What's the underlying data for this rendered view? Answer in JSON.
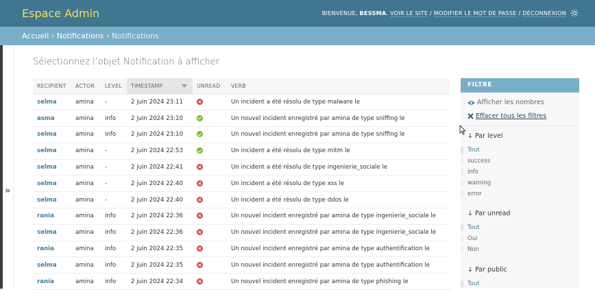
{
  "header": {
    "site_name": "Espace Admin",
    "welcome": "BIENVENUE,",
    "username": "BESSMA",
    "view_site": "VOIR LE SITE",
    "change_password": "MODIFIER LE MOT DE PASSE",
    "logout": "DÉCONNEXION",
    "sep": "/"
  },
  "breadcrumbs": {
    "home": "Accueil",
    "app": "Notifications",
    "current": "Notifications",
    "sep": "›"
  },
  "content": {
    "title": "Sélectionnez l’objet Notification à afficher"
  },
  "table": {
    "columns": [
      "RECIPIENT",
      "ACTOR",
      "LEVEL",
      "TIMESTAMP",
      "UNREAD",
      "VERB"
    ],
    "rows": [
      {
        "recipient": "selma",
        "actor": "amina",
        "level": "-",
        "timestamp": "2 juin 2024 23:11",
        "unread": false,
        "verb": "Un incident a été résolu de type malware le"
      },
      {
        "recipient": "asma",
        "actor": "amina",
        "level": "info",
        "timestamp": "2 juin 2024 23:10",
        "unread": true,
        "verb": "Un nouvel incident enregistré par amina de type sniffing le"
      },
      {
        "recipient": "selma",
        "actor": "amina",
        "level": "info",
        "timestamp": "2 juin 2024 23:10",
        "unread": true,
        "verb": "Un nouvel incident enregistré par amina de type sniffing le"
      },
      {
        "recipient": "selma",
        "actor": "amina",
        "level": "-",
        "timestamp": "2 juin 2024 22:53",
        "unread": true,
        "verb": "Un incident a été résolu de type mitm le"
      },
      {
        "recipient": "selma",
        "actor": "amina",
        "level": "-",
        "timestamp": "2 juin 2024 22:41",
        "unread": false,
        "verb": "Un incident a été résolu de type ingenierie_sociale le"
      },
      {
        "recipient": "selma",
        "actor": "amina",
        "level": "-",
        "timestamp": "2 juin 2024 22:40",
        "unread": false,
        "verb": "Un incident a été résolu de type xss le"
      },
      {
        "recipient": "selma",
        "actor": "amina",
        "level": "-",
        "timestamp": "2 juin 2024 22:40",
        "unread": false,
        "verb": "Un incident a été résolu de type ddos le"
      },
      {
        "recipient": "rania",
        "actor": "amina",
        "level": "info",
        "timestamp": "2 juin 2024 22:36",
        "unread": false,
        "verb": "Un nouvel incident enregistré par amina de type ingenierie_sociale le"
      },
      {
        "recipient": "selma",
        "actor": "amina",
        "level": "info",
        "timestamp": "2 juin 2024 22:36",
        "unread": false,
        "verb": "Un nouvel incident enregistré par amina de type ingenierie_sociale le"
      },
      {
        "recipient": "rania",
        "actor": "amina",
        "level": "info",
        "timestamp": "2 juin 2024 22:35",
        "unread": false,
        "verb": "Un nouvel incident enregistré par amina de type authentification le"
      },
      {
        "recipient": "selma",
        "actor": "amina",
        "level": "info",
        "timestamp": "2 juin 2024 22:35",
        "unread": false,
        "verb": "Un nouvel incident enregistré par amina de type authentification le"
      },
      {
        "recipient": "rania",
        "actor": "amina",
        "level": "info",
        "timestamp": "2 juin 2024 22:34",
        "unread": false,
        "verb": "Un nouvel incident enregistré par amina de type phishing le"
      }
    ]
  },
  "filter": {
    "title": "FILTRE",
    "show_counts": "Afficher les nombres",
    "clear_all": "Effacer tous les filtres",
    "by_level": {
      "heading": "↓ Par level",
      "options": [
        "Tout",
        "success",
        "info",
        "warning",
        "error"
      ]
    },
    "by_unread": {
      "heading": "↓ Par unread",
      "options": [
        "Tout",
        "Oui",
        "Non"
      ]
    },
    "by_public": {
      "heading": "↓ Par public",
      "options": [
        "Tout"
      ]
    }
  },
  "nav_toggle": "»",
  "colors": {
    "header": "#417690",
    "breadcrumbs": "#79aec8",
    "site_name": "#f5dd5d",
    "link": "#447e9b",
    "icon_yes": "#70bf2b",
    "icon_no": "#dd4646"
  }
}
